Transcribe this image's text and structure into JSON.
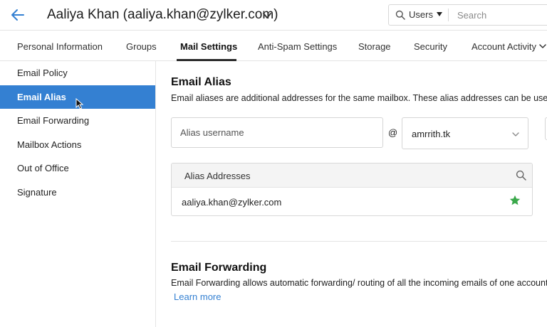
{
  "header": {
    "user_title": "Aaliya Khan (aaliya.khan@zylker.com)",
    "search": {
      "scope": "Users",
      "placeholder": "Search"
    }
  },
  "tabs": [
    {
      "label": "Personal Information",
      "active": false
    },
    {
      "label": "Groups",
      "active": false
    },
    {
      "label": "Mail Settings",
      "active": true
    },
    {
      "label": "Anti-Spam Settings",
      "active": false
    },
    {
      "label": "Storage",
      "active": false
    },
    {
      "label": "Security",
      "active": false
    },
    {
      "label": "Account Activity",
      "active": false
    }
  ],
  "sidebar": {
    "items": [
      {
        "label": "Email Policy",
        "active": false
      },
      {
        "label": "Email Alias",
        "active": true
      },
      {
        "label": "Email Forwarding",
        "active": false
      },
      {
        "label": "Mailbox Actions",
        "active": false
      },
      {
        "label": "Out of Office",
        "active": false
      },
      {
        "label": "Signature",
        "active": false
      }
    ]
  },
  "email_alias": {
    "title": "Email Alias",
    "description": "Email aliases are additional addresses for the same mailbox. These alias addresses can be used to",
    "username_placeholder": "Alias username",
    "at_sign": "@",
    "domain": "amrrith.tk",
    "table": {
      "header": "Alias Addresses",
      "rows": [
        {
          "email": "aaliya.khan@zylker.com",
          "primary": true
        }
      ]
    }
  },
  "email_forwarding": {
    "title": "Email Forwarding",
    "description": "Email Forwarding allows automatic forwarding/ routing of all the incoming emails of one account",
    "learn_more": "Learn more"
  },
  "colors": {
    "accent": "#3480d2",
    "star": "#3aa84a"
  },
  "icons": [
    "back-arrow-icon",
    "chevron-down-icon",
    "search-icon",
    "cursor-icon",
    "star-icon"
  ]
}
